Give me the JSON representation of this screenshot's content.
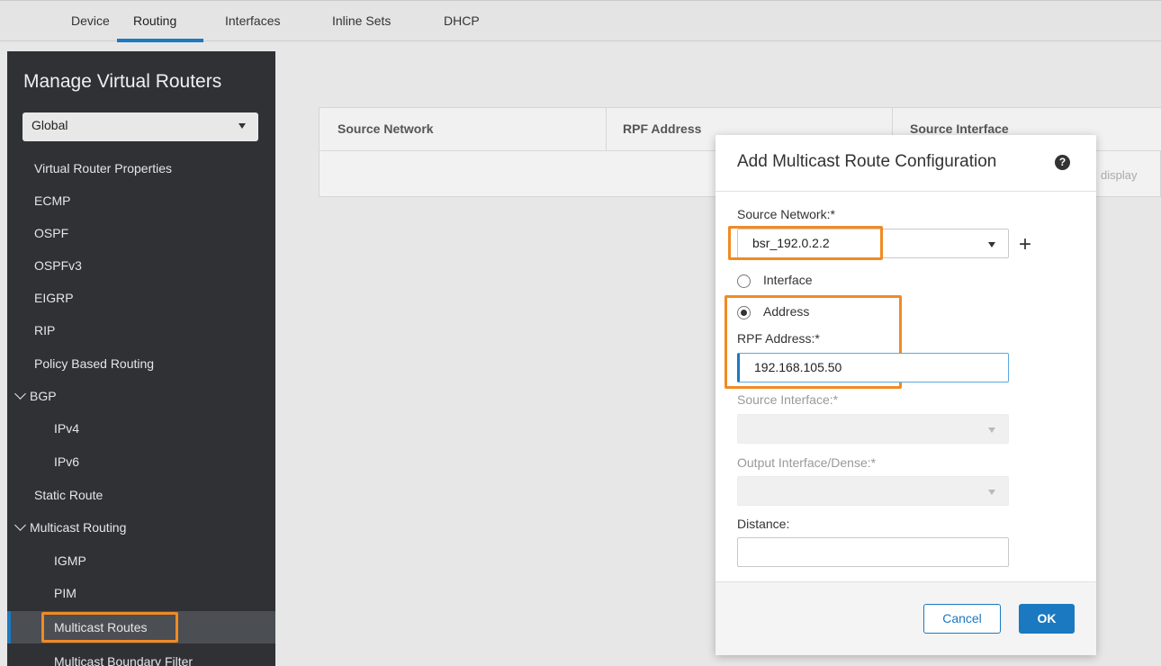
{
  "tabs": [
    "Device",
    "Routing",
    "Interfaces",
    "Inline Sets",
    "DHCP"
  ],
  "active_tab": "Routing",
  "sidebar": {
    "title": "Manage Virtual Routers",
    "router_select": "Global",
    "items": [
      "Virtual Router Properties",
      "ECMP",
      "OSPF",
      "OSPFv3",
      "EIGRP",
      "RIP",
      "Policy Based Routing",
      "BGP",
      "IPv4",
      "IPv6",
      "Static Route",
      "Multicast Routing",
      "IGMP",
      "PIM",
      "Multicast Routes",
      "Multicast Boundary Filter"
    ],
    "selected_item": "Multicast Routes"
  },
  "table": {
    "columns": [
      "Source Network",
      "RPF Address",
      "Source Interface"
    ],
    "empty_text": "display"
  },
  "dialog": {
    "title": "Add Multicast Route Configuration",
    "source_network_label": "Source Network:*",
    "source_network_value": "bsr_192.0.2.2",
    "radio_interface": "Interface",
    "radio_address": "Address",
    "rpf_label": "RPF Address:*",
    "rpf_value": "192.168.105.50",
    "source_interface_label": "Source Interface:*",
    "output_interface_label": "Output Interface/Dense:*",
    "distance_label": "Distance:",
    "distance_value": "",
    "cancel_label": "Cancel",
    "ok_label": "OK"
  },
  "colors": {
    "accent": "#1b79c1",
    "highlight": "#f08a24",
    "sidebar_bg": "#2f3135"
  }
}
